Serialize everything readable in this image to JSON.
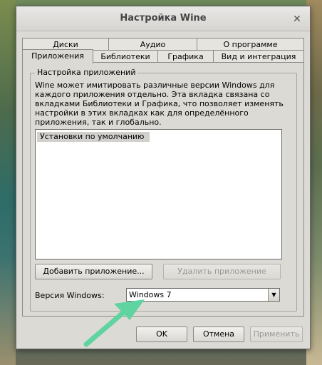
{
  "window": {
    "title": "Настройка Wine"
  },
  "tabs_top": [
    {
      "label": "Диски"
    },
    {
      "label": "Аудио"
    },
    {
      "label": "О программе"
    }
  ],
  "tabs_bottom": [
    {
      "label": "Приложения",
      "active": true
    },
    {
      "label": "Библиотеки"
    },
    {
      "label": "Графика"
    },
    {
      "label": "Вид и интеграция"
    }
  ],
  "app_settings": {
    "group_label": "Настройка приложений",
    "description": "Wine может имитировать различные версии Windows для\nкаждого приложения отдельно. Эта вкладка связана со\nвкладками Библиотеки и Графика, что позволяет изменять\nнастройки в этих вкладках как для определённого\nприложения, так и глобально.",
    "list_items": [
      "Установки по умолчанию"
    ],
    "add_button": "Добавить приложение...",
    "remove_button": "Удалить приложение",
    "version_label": "Версия Windows:",
    "version_value": "Windows 7"
  },
  "footer": {
    "ok": "OK",
    "cancel": "Отмена",
    "apply": "Применить"
  },
  "colors": {
    "annotation_arrow": "#5fd3a0"
  },
  "icons": {
    "close": "close-icon",
    "dropdown": "chevron-down-icon",
    "annotation": "annotation-arrow"
  }
}
